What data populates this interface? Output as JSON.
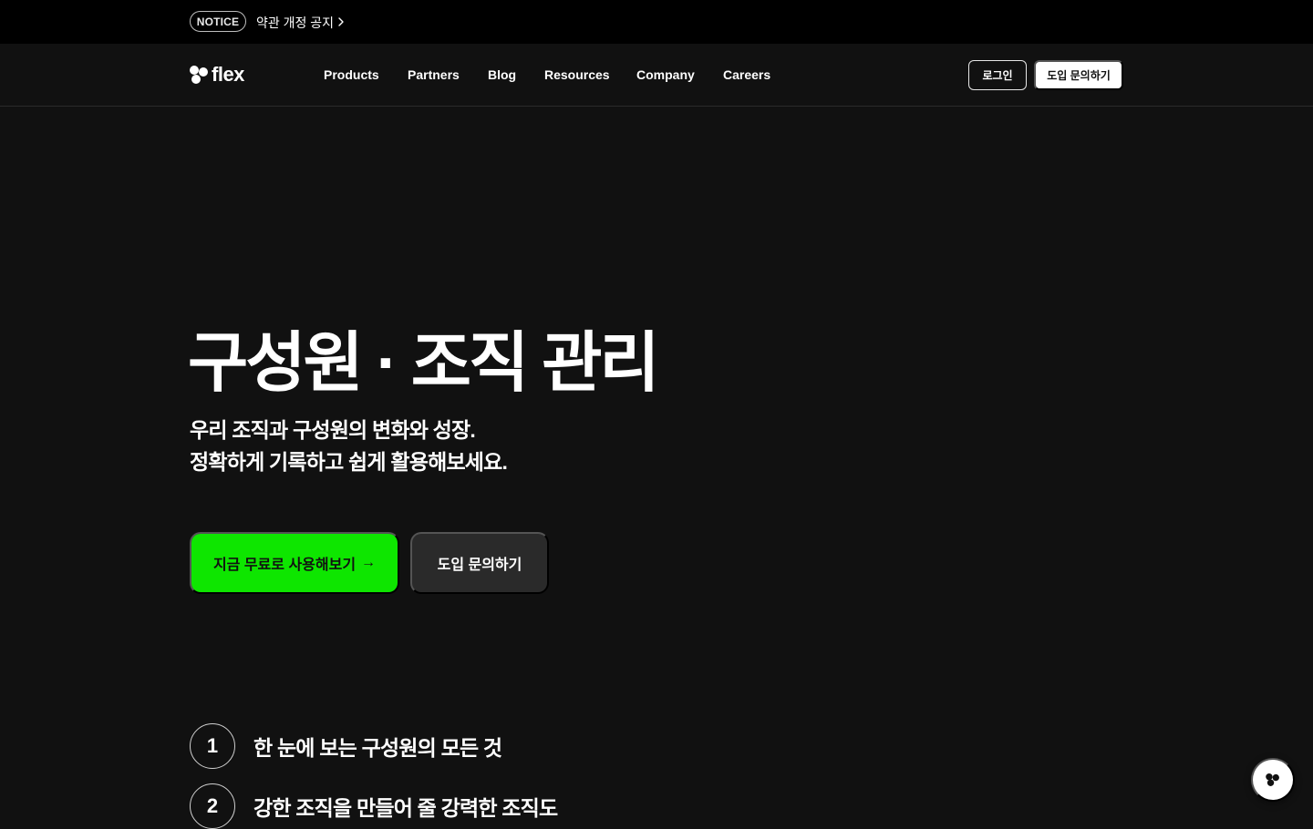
{
  "notice": {
    "badge": "NOTICE",
    "text": "약관 개정 공지"
  },
  "logo": {
    "word": "flex"
  },
  "nav": {
    "items": [
      "Products",
      "Partners",
      "Blog",
      "Resources",
      "Company",
      "Careers"
    ],
    "login_label": "로그인",
    "inquiry_label": "도입 문의하기"
  },
  "hero": {
    "title": "구성원 · 조직 관리",
    "subtitle_line1": "우리 조직과 구성원의 변화와 성장.",
    "subtitle_line2": "정확하게 기록하고 쉽게 활용해보세요.",
    "primary_cta": "지금 무료로 사용해보기",
    "primary_cta_arrow": "→",
    "secondary_cta": "도입 문의하기"
  },
  "features": [
    {
      "num": "1",
      "text": "한 눈에 보는 구성원의 모든 것"
    },
    {
      "num": "2",
      "text": "강한 조직을 만들어 줄 강력한 조직도"
    }
  ],
  "colors": {
    "background": "#111111",
    "notice_bar": "#000000",
    "accent_green": "#0ee600",
    "secondary_button": "#2a2a2a"
  }
}
